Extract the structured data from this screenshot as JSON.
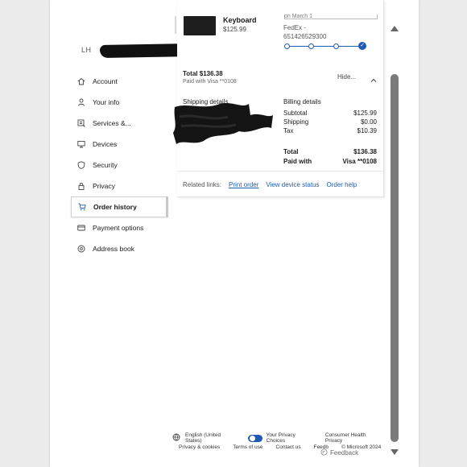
{
  "user": {
    "initials": "LH"
  },
  "sidebar": {
    "items": [
      {
        "label": "Account",
        "icon": "home-icon",
        "active": false
      },
      {
        "label": "Your info",
        "icon": "person-icon",
        "active": false
      },
      {
        "label": "Services &...",
        "icon": "services-icon",
        "active": false
      },
      {
        "label": "Devices",
        "icon": "monitor-icon",
        "active": false
      },
      {
        "label": "Security",
        "icon": "shield-icon",
        "active": false
      },
      {
        "label": "Privacy",
        "icon": "lock-icon",
        "active": false
      },
      {
        "label": "Order history",
        "icon": "cart-icon",
        "active": true
      },
      {
        "label": "Payment options",
        "icon": "card-icon",
        "active": false
      },
      {
        "label": "Address book",
        "icon": "location-pin-icon",
        "active": false
      }
    ]
  },
  "order": {
    "product_name": "Keyboard",
    "product_price": "$125.99",
    "tracking_top_text": "on March 1",
    "carrier": "FedEx -",
    "tracking_number": "651426529300",
    "total_label": "Total $136.38",
    "paid_with_line": "Paid with Visa **0108",
    "hide_label": "Hide...",
    "shipping_title": "Shipping details",
    "billing_title": "Billing details",
    "billing": {
      "subtotal_label": "Subtotal",
      "subtotal": "$125.99",
      "shipping_label": "Shipping",
      "shipping": "$0.00",
      "tax_label": "Tax",
      "tax": "$10.39",
      "total_label": "Total",
      "total": "$136.38",
      "paid_label": "Paid with",
      "paid": "Visa **0108"
    },
    "related_label": "Related links:",
    "links": [
      "Print order",
      "View device status",
      "Order help"
    ]
  },
  "footer": {
    "language": "English (United States)",
    "privacy_choices": "Your Privacy Choices",
    "consumer_health": "Consumer Health Privacy",
    "links": [
      "Privacy & cookies",
      "Terms of use",
      "Contact us",
      "Feedb",
      "© Microsoft 2024"
    ]
  },
  "feedback_label": "Feedback",
  "colors": {
    "accent": "#1f5ab4",
    "active_border": "#c8c8c8"
  }
}
